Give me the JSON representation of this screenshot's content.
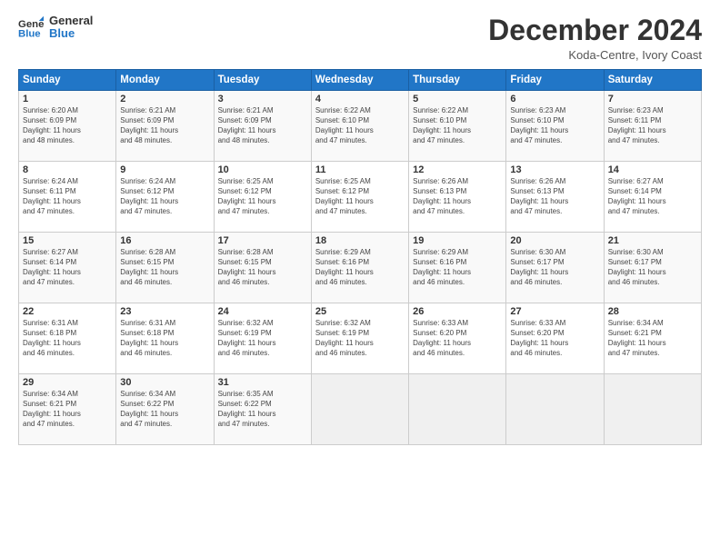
{
  "logo": {
    "line1": "General",
    "line2": "Blue"
  },
  "title": "December 2024",
  "subtitle": "Koda-Centre, Ivory Coast",
  "header_days": [
    "Sunday",
    "Monday",
    "Tuesday",
    "Wednesday",
    "Thursday",
    "Friday",
    "Saturday"
  ],
  "weeks": [
    [
      {
        "day": "1",
        "lines": [
          "Sunrise: 6:20 AM",
          "Sunset: 6:09 PM",
          "Daylight: 11 hours",
          "and 48 minutes."
        ]
      },
      {
        "day": "2",
        "lines": [
          "Sunrise: 6:21 AM",
          "Sunset: 6:09 PM",
          "Daylight: 11 hours",
          "and 48 minutes."
        ]
      },
      {
        "day": "3",
        "lines": [
          "Sunrise: 6:21 AM",
          "Sunset: 6:09 PM",
          "Daylight: 11 hours",
          "and 48 minutes."
        ]
      },
      {
        "day": "4",
        "lines": [
          "Sunrise: 6:22 AM",
          "Sunset: 6:10 PM",
          "Daylight: 11 hours",
          "and 47 minutes."
        ]
      },
      {
        "day": "5",
        "lines": [
          "Sunrise: 6:22 AM",
          "Sunset: 6:10 PM",
          "Daylight: 11 hours",
          "and 47 minutes."
        ]
      },
      {
        "day": "6",
        "lines": [
          "Sunrise: 6:23 AM",
          "Sunset: 6:10 PM",
          "Daylight: 11 hours",
          "and 47 minutes."
        ]
      },
      {
        "day": "7",
        "lines": [
          "Sunrise: 6:23 AM",
          "Sunset: 6:11 PM",
          "Daylight: 11 hours",
          "and 47 minutes."
        ]
      }
    ],
    [
      {
        "day": "8",
        "lines": [
          "Sunrise: 6:24 AM",
          "Sunset: 6:11 PM",
          "Daylight: 11 hours",
          "and 47 minutes."
        ]
      },
      {
        "day": "9",
        "lines": [
          "Sunrise: 6:24 AM",
          "Sunset: 6:12 PM",
          "Daylight: 11 hours",
          "and 47 minutes."
        ]
      },
      {
        "day": "10",
        "lines": [
          "Sunrise: 6:25 AM",
          "Sunset: 6:12 PM",
          "Daylight: 11 hours",
          "and 47 minutes."
        ]
      },
      {
        "day": "11",
        "lines": [
          "Sunrise: 6:25 AM",
          "Sunset: 6:12 PM",
          "Daylight: 11 hours",
          "and 47 minutes."
        ]
      },
      {
        "day": "12",
        "lines": [
          "Sunrise: 6:26 AM",
          "Sunset: 6:13 PM",
          "Daylight: 11 hours",
          "and 47 minutes."
        ]
      },
      {
        "day": "13",
        "lines": [
          "Sunrise: 6:26 AM",
          "Sunset: 6:13 PM",
          "Daylight: 11 hours",
          "and 47 minutes."
        ]
      },
      {
        "day": "14",
        "lines": [
          "Sunrise: 6:27 AM",
          "Sunset: 6:14 PM",
          "Daylight: 11 hours",
          "and 47 minutes."
        ]
      }
    ],
    [
      {
        "day": "15",
        "lines": [
          "Sunrise: 6:27 AM",
          "Sunset: 6:14 PM",
          "Daylight: 11 hours",
          "and 47 minutes."
        ]
      },
      {
        "day": "16",
        "lines": [
          "Sunrise: 6:28 AM",
          "Sunset: 6:15 PM",
          "Daylight: 11 hours",
          "and 46 minutes."
        ]
      },
      {
        "day": "17",
        "lines": [
          "Sunrise: 6:28 AM",
          "Sunset: 6:15 PM",
          "Daylight: 11 hours",
          "and 46 minutes."
        ]
      },
      {
        "day": "18",
        "lines": [
          "Sunrise: 6:29 AM",
          "Sunset: 6:16 PM",
          "Daylight: 11 hours",
          "and 46 minutes."
        ]
      },
      {
        "day": "19",
        "lines": [
          "Sunrise: 6:29 AM",
          "Sunset: 6:16 PM",
          "Daylight: 11 hours",
          "and 46 minutes."
        ]
      },
      {
        "day": "20",
        "lines": [
          "Sunrise: 6:30 AM",
          "Sunset: 6:17 PM",
          "Daylight: 11 hours",
          "and 46 minutes."
        ]
      },
      {
        "day": "21",
        "lines": [
          "Sunrise: 6:30 AM",
          "Sunset: 6:17 PM",
          "Daylight: 11 hours",
          "and 46 minutes."
        ]
      }
    ],
    [
      {
        "day": "22",
        "lines": [
          "Sunrise: 6:31 AM",
          "Sunset: 6:18 PM",
          "Daylight: 11 hours",
          "and 46 minutes."
        ]
      },
      {
        "day": "23",
        "lines": [
          "Sunrise: 6:31 AM",
          "Sunset: 6:18 PM",
          "Daylight: 11 hours",
          "and 46 minutes."
        ]
      },
      {
        "day": "24",
        "lines": [
          "Sunrise: 6:32 AM",
          "Sunset: 6:19 PM",
          "Daylight: 11 hours",
          "and 46 minutes."
        ]
      },
      {
        "day": "25",
        "lines": [
          "Sunrise: 6:32 AM",
          "Sunset: 6:19 PM",
          "Daylight: 11 hours",
          "and 46 minutes."
        ]
      },
      {
        "day": "26",
        "lines": [
          "Sunrise: 6:33 AM",
          "Sunset: 6:20 PM",
          "Daylight: 11 hours",
          "and 46 minutes."
        ]
      },
      {
        "day": "27",
        "lines": [
          "Sunrise: 6:33 AM",
          "Sunset: 6:20 PM",
          "Daylight: 11 hours",
          "and 46 minutes."
        ]
      },
      {
        "day": "28",
        "lines": [
          "Sunrise: 6:34 AM",
          "Sunset: 6:21 PM",
          "Daylight: 11 hours",
          "and 47 minutes."
        ]
      }
    ],
    [
      {
        "day": "29",
        "lines": [
          "Sunrise: 6:34 AM",
          "Sunset: 6:21 PM",
          "Daylight: 11 hours",
          "and 47 minutes."
        ]
      },
      {
        "day": "30",
        "lines": [
          "Sunrise: 6:34 AM",
          "Sunset: 6:22 PM",
          "Daylight: 11 hours",
          "and 47 minutes."
        ]
      },
      {
        "day": "31",
        "lines": [
          "Sunrise: 6:35 AM",
          "Sunset: 6:22 PM",
          "Daylight: 11 hours",
          "and 47 minutes."
        ]
      },
      null,
      null,
      null,
      null
    ]
  ]
}
